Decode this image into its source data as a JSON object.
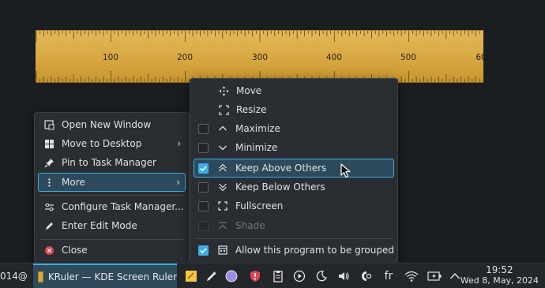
{
  "ruler": {
    "labels": [
      "100",
      "200",
      "300",
      "400",
      "500",
      "60"
    ]
  },
  "task_menu": {
    "items": [
      {
        "label": "Open New Window",
        "icon": "new-window-icon"
      },
      {
        "label": "Move to Desktop",
        "icon": "desktop-icon",
        "submenu": true
      },
      {
        "label": "Pin to Task Manager",
        "icon": "pin-icon"
      },
      {
        "label": "More",
        "icon": "more-dots-icon",
        "submenu": true,
        "highlighted": true
      },
      {
        "label": "Configure Task Manager...",
        "icon": "configure-icon"
      },
      {
        "label": "Enter Edit Mode",
        "icon": "edit-icon"
      },
      {
        "label": "Close",
        "icon": "close-icon"
      }
    ]
  },
  "more_menu": {
    "items": [
      {
        "label": "Move",
        "icon": "move-icon",
        "checkbox": null
      },
      {
        "label": "Resize",
        "icon": "resize-icon",
        "checkbox": null
      },
      {
        "label": "Maximize",
        "icon": "maximize-icon",
        "checkbox": false
      },
      {
        "label": "Minimize",
        "icon": "minimize-icon",
        "checkbox": false
      },
      {
        "label": "Keep Above Others",
        "icon": "keep-above-icon",
        "checkbox": true,
        "highlighted": true
      },
      {
        "label": "Keep Below Others",
        "icon": "keep-below-icon",
        "checkbox": false
      },
      {
        "label": "Fullscreen",
        "icon": "fullscreen-icon",
        "checkbox": false
      },
      {
        "label": "Shade",
        "icon": "shade-icon",
        "checkbox": false,
        "disabled": true
      },
      {
        "label": "Allow this program to be grouped",
        "icon": "group-icon",
        "checkbox": true
      }
    ]
  },
  "taskbar": {
    "left_partial": "014@",
    "task_title": "KRuler — KDE Screen Ruler",
    "keyboard_layout": "fr",
    "clock_time": "19:52",
    "clock_date": "Wed 8, May, 2024"
  },
  "colors": {
    "accent": "#3daee9",
    "menu_bg": "#2a2e32",
    "highlight_bg": "#2c4a5c",
    "ruler_gold": "#d9a944",
    "close_red": "#da4453"
  }
}
